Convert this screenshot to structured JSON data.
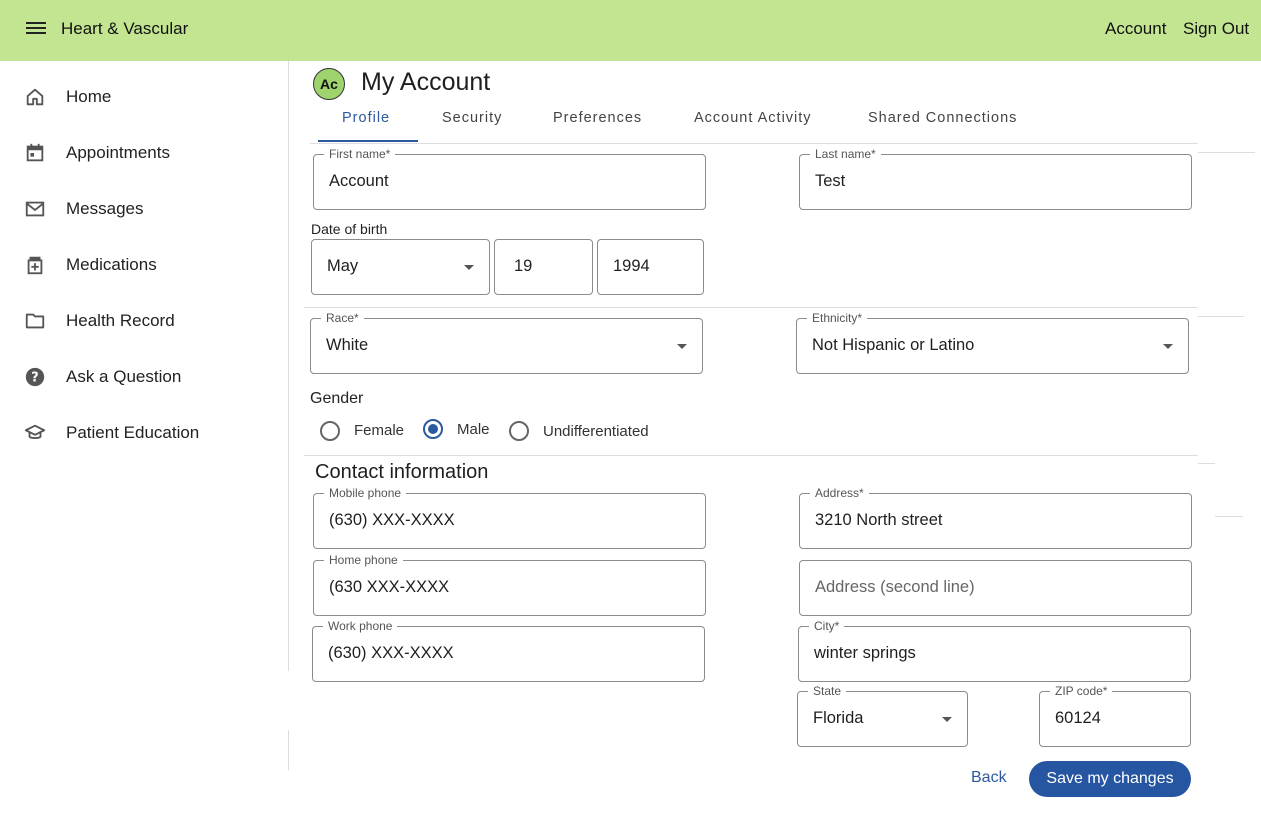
{
  "header": {
    "title": "Heart & Vascular",
    "account_link": "Account",
    "signout_link": "Sign Out"
  },
  "sidebar": {
    "items": [
      {
        "label": "Home",
        "icon": "home-icon"
      },
      {
        "label": "Appointments",
        "icon": "calendar-icon"
      },
      {
        "label": "Messages",
        "icon": "mail-icon"
      },
      {
        "label": "Medications",
        "icon": "medication-icon"
      },
      {
        "label": "Health Record",
        "icon": "folder-icon"
      },
      {
        "label": "Ask a Question",
        "icon": "help-icon"
      },
      {
        "label": "Patient Education",
        "icon": "school-icon"
      }
    ]
  },
  "page": {
    "avatar": "Ac",
    "title": "My Account",
    "tabs": [
      "Profile",
      "Security",
      "Preferences",
      "Account Activity",
      "Shared Connections"
    ],
    "active_tab": "Profile"
  },
  "profile": {
    "first_name": {
      "label": "First name*",
      "value": "Account"
    },
    "last_name": {
      "label": "Last name*",
      "value": "Test"
    },
    "dob_label": "Date of birth",
    "dob_month": "May",
    "dob_day": "19",
    "dob_year": "1994",
    "race": {
      "label": "Race*",
      "value": "White"
    },
    "ethnicity": {
      "label": "Ethnicity*",
      "value": "Not Hispanic or Latino"
    },
    "gender_label": "Gender",
    "gender_options": [
      "Female",
      "Male",
      "Undifferentiated"
    ],
    "gender_selected": "Male"
  },
  "contact": {
    "title": "Contact information",
    "mobile_phone": {
      "label": "Mobile phone",
      "value": "(630) XXX-XXXX"
    },
    "home_phone": {
      "label": "Home phone",
      "value": "(630 XXX-XXXX"
    },
    "work_phone": {
      "label": "Work phone",
      "value": "(630) XXX-XXXX"
    },
    "address": {
      "label": "Address*",
      "value": "3210 North street"
    },
    "address2": {
      "placeholder": "Address (second line)"
    },
    "city": {
      "label": "City*",
      "value": "winter springs"
    },
    "state": {
      "label": "State",
      "value": "Florida"
    },
    "zip": {
      "label": "ZIP code*",
      "value": "60124"
    }
  },
  "actions": {
    "back": "Back",
    "save": "Save my changes"
  },
  "colors": {
    "header_bg": "#c3e591",
    "accent": "#2b5a9e",
    "button_bg": "#2656a2",
    "avatar_bg": "#9ed36e"
  }
}
